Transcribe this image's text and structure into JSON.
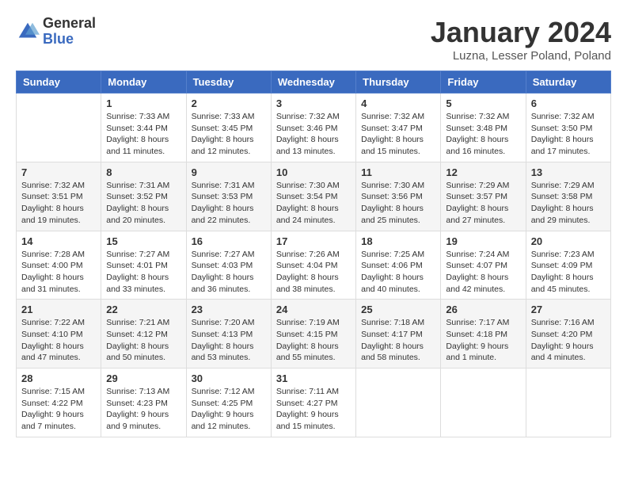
{
  "logo": {
    "general": "General",
    "blue": "Blue"
  },
  "title": "January 2024",
  "subtitle": "Luzna, Lesser Poland, Poland",
  "days_header": [
    "Sunday",
    "Monday",
    "Tuesday",
    "Wednesday",
    "Thursday",
    "Friday",
    "Saturday"
  ],
  "weeks": [
    [
      {
        "day": "",
        "info": ""
      },
      {
        "day": "1",
        "info": "Sunrise: 7:33 AM\nSunset: 3:44 PM\nDaylight: 8 hours\nand 11 minutes."
      },
      {
        "day": "2",
        "info": "Sunrise: 7:33 AM\nSunset: 3:45 PM\nDaylight: 8 hours\nand 12 minutes."
      },
      {
        "day": "3",
        "info": "Sunrise: 7:32 AM\nSunset: 3:46 PM\nDaylight: 8 hours\nand 13 minutes."
      },
      {
        "day": "4",
        "info": "Sunrise: 7:32 AM\nSunset: 3:47 PM\nDaylight: 8 hours\nand 15 minutes."
      },
      {
        "day": "5",
        "info": "Sunrise: 7:32 AM\nSunset: 3:48 PM\nDaylight: 8 hours\nand 16 minutes."
      },
      {
        "day": "6",
        "info": "Sunrise: 7:32 AM\nSunset: 3:50 PM\nDaylight: 8 hours\nand 17 minutes."
      }
    ],
    [
      {
        "day": "7",
        "info": "Sunrise: 7:32 AM\nSunset: 3:51 PM\nDaylight: 8 hours\nand 19 minutes."
      },
      {
        "day": "8",
        "info": "Sunrise: 7:31 AM\nSunset: 3:52 PM\nDaylight: 8 hours\nand 20 minutes."
      },
      {
        "day": "9",
        "info": "Sunrise: 7:31 AM\nSunset: 3:53 PM\nDaylight: 8 hours\nand 22 minutes."
      },
      {
        "day": "10",
        "info": "Sunrise: 7:30 AM\nSunset: 3:54 PM\nDaylight: 8 hours\nand 24 minutes."
      },
      {
        "day": "11",
        "info": "Sunrise: 7:30 AM\nSunset: 3:56 PM\nDaylight: 8 hours\nand 25 minutes."
      },
      {
        "day": "12",
        "info": "Sunrise: 7:29 AM\nSunset: 3:57 PM\nDaylight: 8 hours\nand 27 minutes."
      },
      {
        "day": "13",
        "info": "Sunrise: 7:29 AM\nSunset: 3:58 PM\nDaylight: 8 hours\nand 29 minutes."
      }
    ],
    [
      {
        "day": "14",
        "info": "Sunrise: 7:28 AM\nSunset: 4:00 PM\nDaylight: 8 hours\nand 31 minutes."
      },
      {
        "day": "15",
        "info": "Sunrise: 7:27 AM\nSunset: 4:01 PM\nDaylight: 8 hours\nand 33 minutes."
      },
      {
        "day": "16",
        "info": "Sunrise: 7:27 AM\nSunset: 4:03 PM\nDaylight: 8 hours\nand 36 minutes."
      },
      {
        "day": "17",
        "info": "Sunrise: 7:26 AM\nSunset: 4:04 PM\nDaylight: 8 hours\nand 38 minutes."
      },
      {
        "day": "18",
        "info": "Sunrise: 7:25 AM\nSunset: 4:06 PM\nDaylight: 8 hours\nand 40 minutes."
      },
      {
        "day": "19",
        "info": "Sunrise: 7:24 AM\nSunset: 4:07 PM\nDaylight: 8 hours\nand 42 minutes."
      },
      {
        "day": "20",
        "info": "Sunrise: 7:23 AM\nSunset: 4:09 PM\nDaylight: 8 hours\nand 45 minutes."
      }
    ],
    [
      {
        "day": "21",
        "info": "Sunrise: 7:22 AM\nSunset: 4:10 PM\nDaylight: 8 hours\nand 47 minutes."
      },
      {
        "day": "22",
        "info": "Sunrise: 7:21 AM\nSunset: 4:12 PM\nDaylight: 8 hours\nand 50 minutes."
      },
      {
        "day": "23",
        "info": "Sunrise: 7:20 AM\nSunset: 4:13 PM\nDaylight: 8 hours\nand 53 minutes."
      },
      {
        "day": "24",
        "info": "Sunrise: 7:19 AM\nSunset: 4:15 PM\nDaylight: 8 hours\nand 55 minutes."
      },
      {
        "day": "25",
        "info": "Sunrise: 7:18 AM\nSunset: 4:17 PM\nDaylight: 8 hours\nand 58 minutes."
      },
      {
        "day": "26",
        "info": "Sunrise: 7:17 AM\nSunset: 4:18 PM\nDaylight: 9 hours\nand 1 minute."
      },
      {
        "day": "27",
        "info": "Sunrise: 7:16 AM\nSunset: 4:20 PM\nDaylight: 9 hours\nand 4 minutes."
      }
    ],
    [
      {
        "day": "28",
        "info": "Sunrise: 7:15 AM\nSunset: 4:22 PM\nDaylight: 9 hours\nand 7 minutes."
      },
      {
        "day": "29",
        "info": "Sunrise: 7:13 AM\nSunset: 4:23 PM\nDaylight: 9 hours\nand 9 minutes."
      },
      {
        "day": "30",
        "info": "Sunrise: 7:12 AM\nSunset: 4:25 PM\nDaylight: 9 hours\nand 12 minutes."
      },
      {
        "day": "31",
        "info": "Sunrise: 7:11 AM\nSunset: 4:27 PM\nDaylight: 9 hours\nand 15 minutes."
      },
      {
        "day": "",
        "info": ""
      },
      {
        "day": "",
        "info": ""
      },
      {
        "day": "",
        "info": ""
      }
    ]
  ]
}
